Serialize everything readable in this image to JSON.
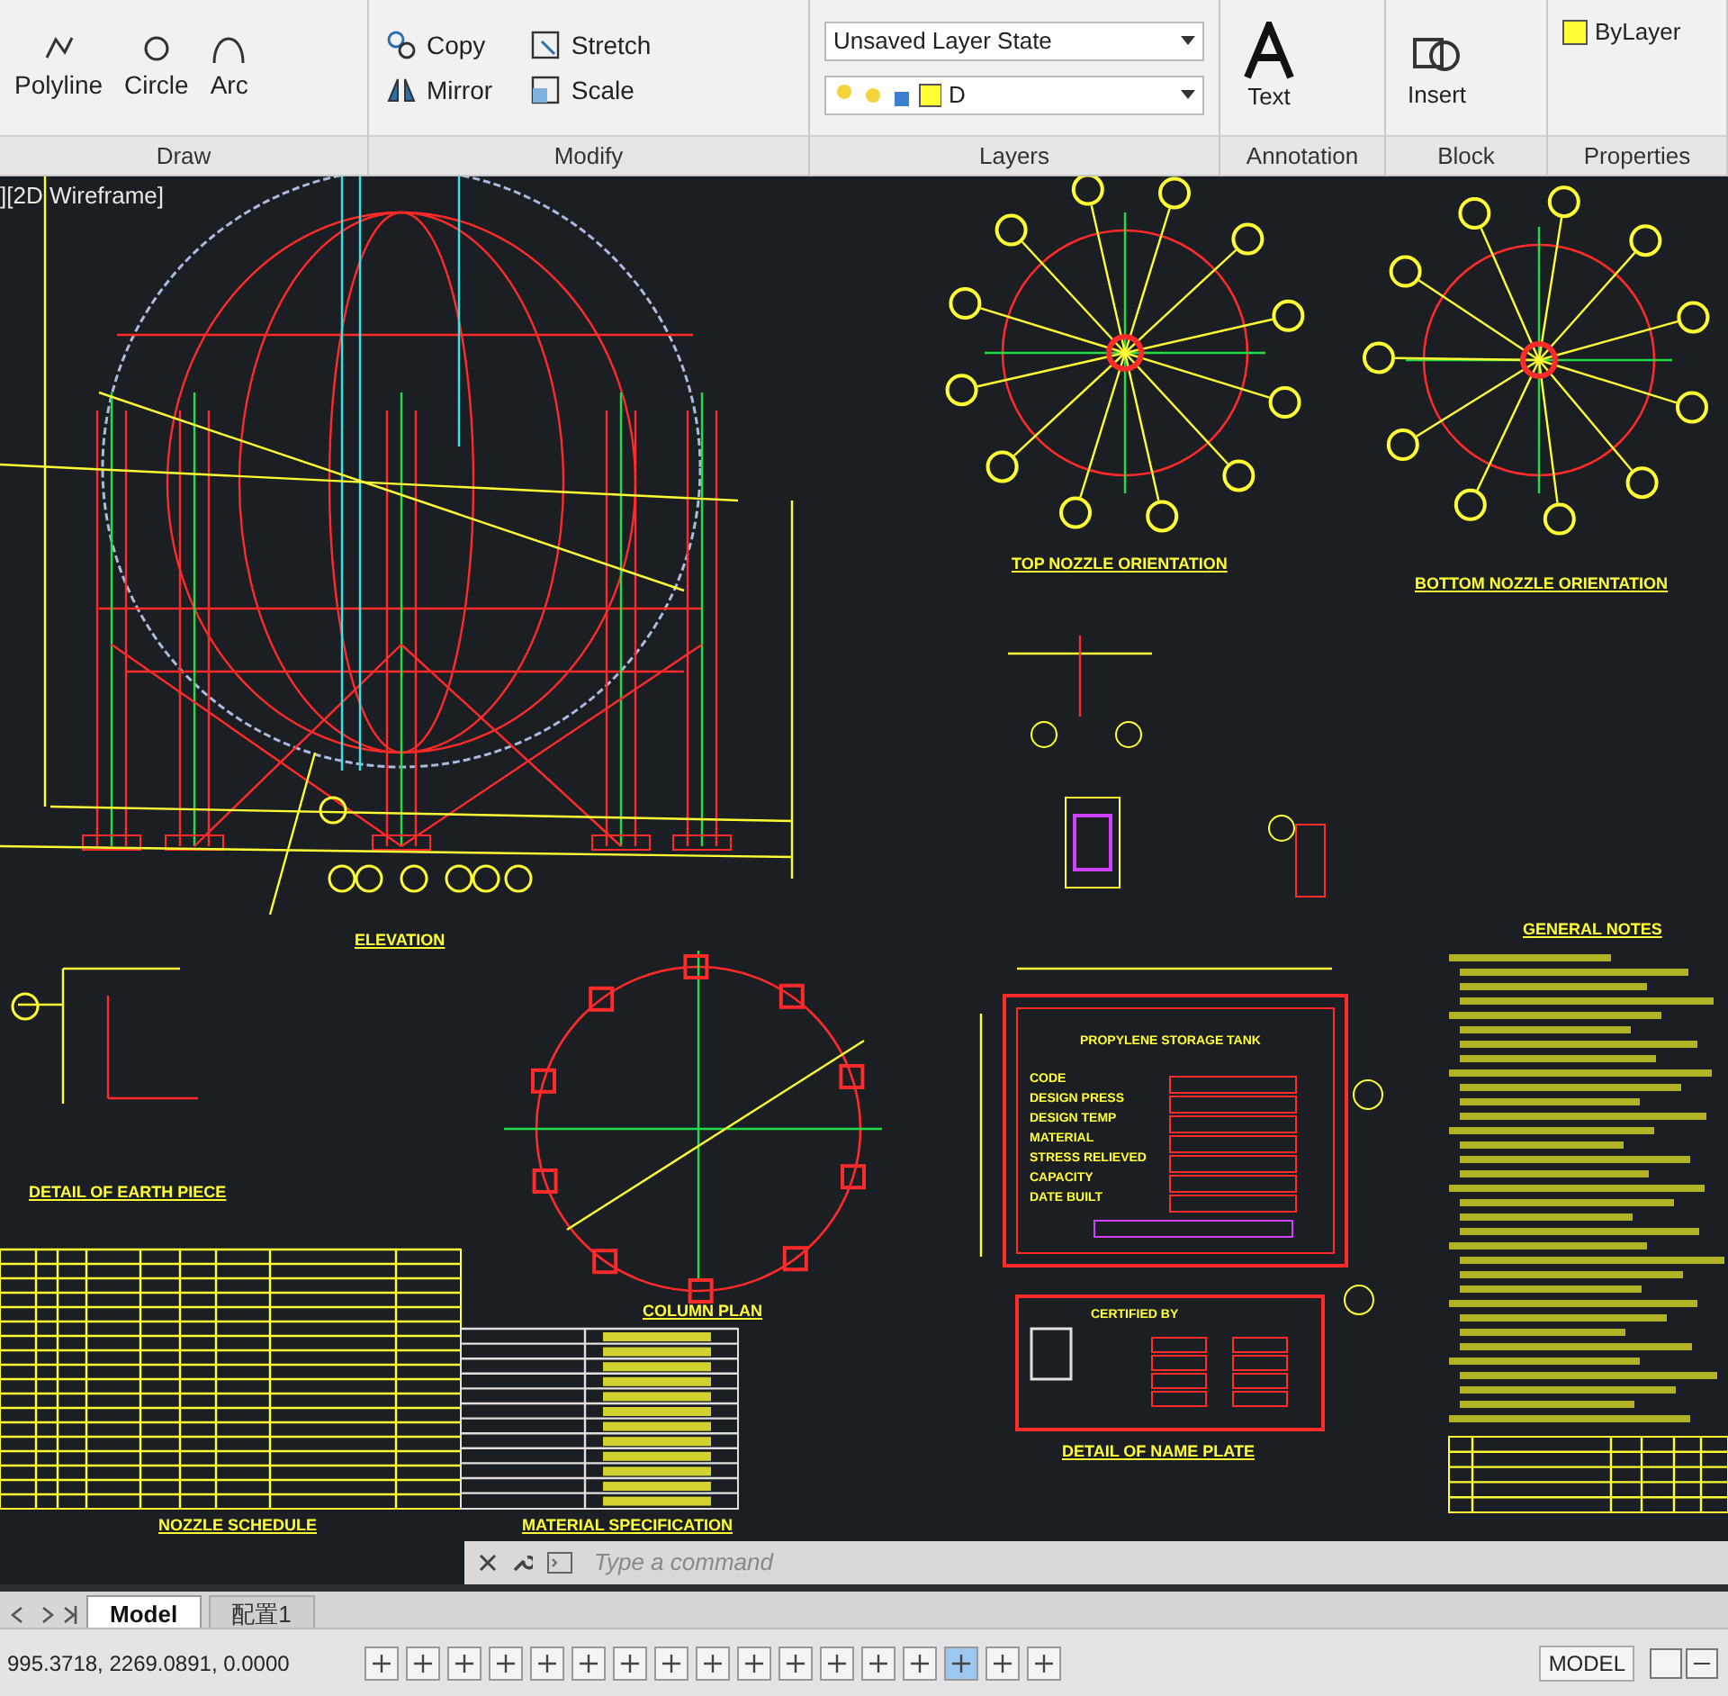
{
  "ribbon": {
    "panels": [
      {
        "kind": "tools",
        "title": "Draw",
        "tools": [
          {
            "label": "Polyline"
          },
          {
            "label": "Circle"
          },
          {
            "label": "Arc"
          }
        ]
      },
      {
        "kind": "tools",
        "title": "Modify",
        "tools": [
          {
            "label": "Copy"
          },
          {
            "label": "Stretch"
          },
          {
            "label": "Mirror"
          },
          {
            "label": "Scale"
          }
        ]
      },
      {
        "kind": "layers",
        "title": "Layers",
        "layer_state": "Unsaved Layer State",
        "current_layer": "D"
      },
      {
        "kind": "tools",
        "title": "Annotation",
        "tools": [
          {
            "label": "Text"
          }
        ]
      },
      {
        "kind": "tools",
        "title": "Block",
        "tools": [
          {
            "label": "Insert"
          }
        ]
      },
      {
        "kind": "properties",
        "title": "Properties",
        "color_setting": "ByLayer"
      }
    ]
  },
  "viewport_label": "][2D Wireframe]",
  "drawing": {
    "titles": [
      "TOP NOZZLE ORIENTATION",
      "BOTTOM NOZZLE ORIENTATION",
      "ELEVATION",
      "DETAIL OF EARTH PIECE",
      "COLUMN PLAN",
      "DETAIL OF NAME PLATE",
      "NOZZLE SCHEDULE",
      "MATERIAL SPECIFICATION",
      "GENERAL NOTES"
    ],
    "name_plate": {
      "title": "PROPYLENE STORAGE TANK",
      "fields": [
        "CODE",
        "DESIGN PRESS",
        "DESIGN TEMP",
        "MATERIAL",
        "STRESS RELIEVED",
        "CAPACITY",
        "DATE BUILT"
      ]
    },
    "certified_by": "CERTIFIED BY"
  },
  "command_line": {
    "placeholder": "Type a command"
  },
  "layout_tabs": [
    {
      "label": "Model",
      "selected": true
    },
    {
      "label": "配置1",
      "selected": false
    }
  ],
  "status_bar": {
    "coordinates": "995.3718, 2269.0891, 0.0000",
    "space": "MODEL"
  }
}
